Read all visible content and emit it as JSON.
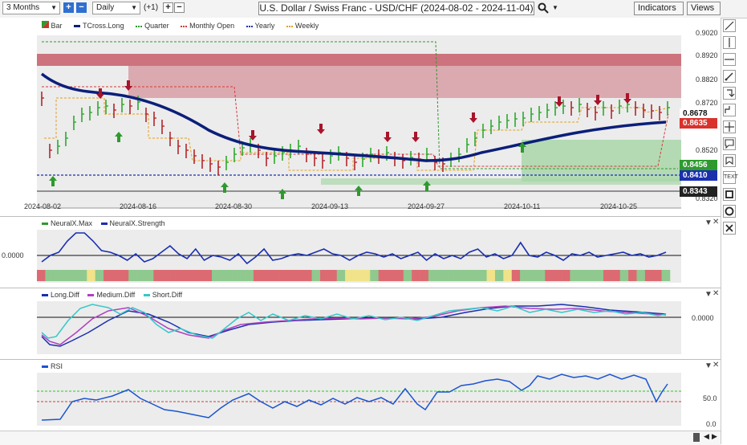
{
  "toolbar": {
    "period": "3 Months",
    "interval": "Daily",
    "offset": "(+1)",
    "title": "U.S. Dollar / Swiss Franc - USD/CHF (2024-08-02 - 2024-11-04)",
    "indicators_label": "Indicators",
    "views_label": "Views"
  },
  "price_pane": {
    "legend": [
      {
        "label": "Bar",
        "color": "#c0392b"
      },
      {
        "label": "TCross.Long",
        "color": "#0b1f7a"
      },
      {
        "label": "Quarter",
        "color": "#2e9a2e"
      },
      {
        "label": "Monthly Open",
        "color": "#d43a3a"
      },
      {
        "label": "Yearly",
        "color": "#1a2fb0"
      },
      {
        "label": "Weekly",
        "color": "#e0a020"
      }
    ],
    "y_ticks": [
      "0.9020",
      "0.8920",
      "0.8820",
      "0.8720",
      "0.8520",
      "0.8320"
    ],
    "x_ticks": [
      "2024-08-02",
      "2024-08-16",
      "2024-08-30",
      "2024-09-13",
      "2024-09-27",
      "2024-10-11",
      "2024-10-25"
    ],
    "price_tags": [
      {
        "value": "0.8678",
        "bg": "#ffffff",
        "fg": "#111111"
      },
      {
        "value": "0.8635",
        "bg": "#d9322c",
        "fg": "#ffffff"
      },
      {
        "value": "0.8456",
        "bg": "#2e9a2e",
        "fg": "#ffffff"
      },
      {
        "value": "0.8410",
        "bg": "#1a2fb0",
        "fg": "#ffffff"
      },
      {
        "value": "0.8343",
        "bg": "#222222",
        "fg": "#ffffff"
      }
    ]
  },
  "neuralx_pane": {
    "legend": [
      {
        "label": "NeuralX.Max",
        "color": "#2e9a2e"
      },
      {
        "label": "NeuralX.Strength",
        "color": "#1a2fb0"
      }
    ],
    "left_value": "0.0000"
  },
  "diff_pane": {
    "legend": [
      {
        "label": "Long.Diff",
        "color": "#1a2fb0"
      },
      {
        "label": "Medium.Diff",
        "color": "#b040c0"
      },
      {
        "label": "Short.Diff",
        "color": "#35c8c8"
      }
    ],
    "right_value": "0.0000"
  },
  "rsi_pane": {
    "legend": [
      {
        "label": "RSI",
        "color": "#1a55d0"
      }
    ],
    "y_ticks": [
      "50.0",
      "0.0"
    ]
  },
  "colors": {
    "up_bar": "#2ea82e",
    "down_bar": "#b3262b",
    "resistance_zone": "#c8707a",
    "support_zone": "#8fc98f"
  }
}
